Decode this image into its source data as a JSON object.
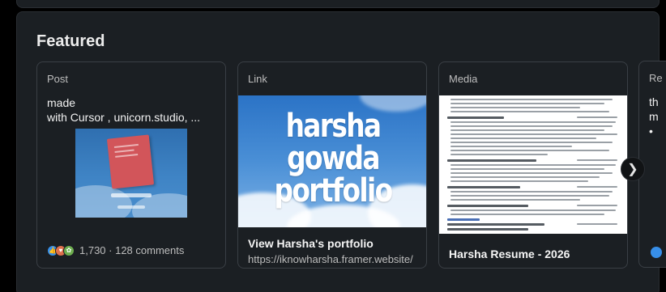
{
  "section": {
    "title": "Featured"
  },
  "cards": [
    {
      "type": "Post",
      "text": "made\nwith Cursor , unicorn.studio, ...",
      "reactions": [
        "like-icon",
        "love-icon",
        "support-icon"
      ],
      "stats": "1,730 · 128 comments"
    },
    {
      "type": "Link",
      "image_text": "harsha gowda portfolio",
      "title": "View Harsha's portfolio",
      "url": "https://iknowharsha.framer.website/"
    },
    {
      "type": "Media",
      "title": "Harsha Resume - 2026"
    }
  ],
  "peek_card": {
    "type": "Re",
    "text": "th\nm\n•"
  },
  "next_button": {
    "label": "❯"
  },
  "colors": {
    "background": "#000000",
    "card": "#1b1f23",
    "border": "#3a3f45",
    "accent": "#378fe9"
  }
}
